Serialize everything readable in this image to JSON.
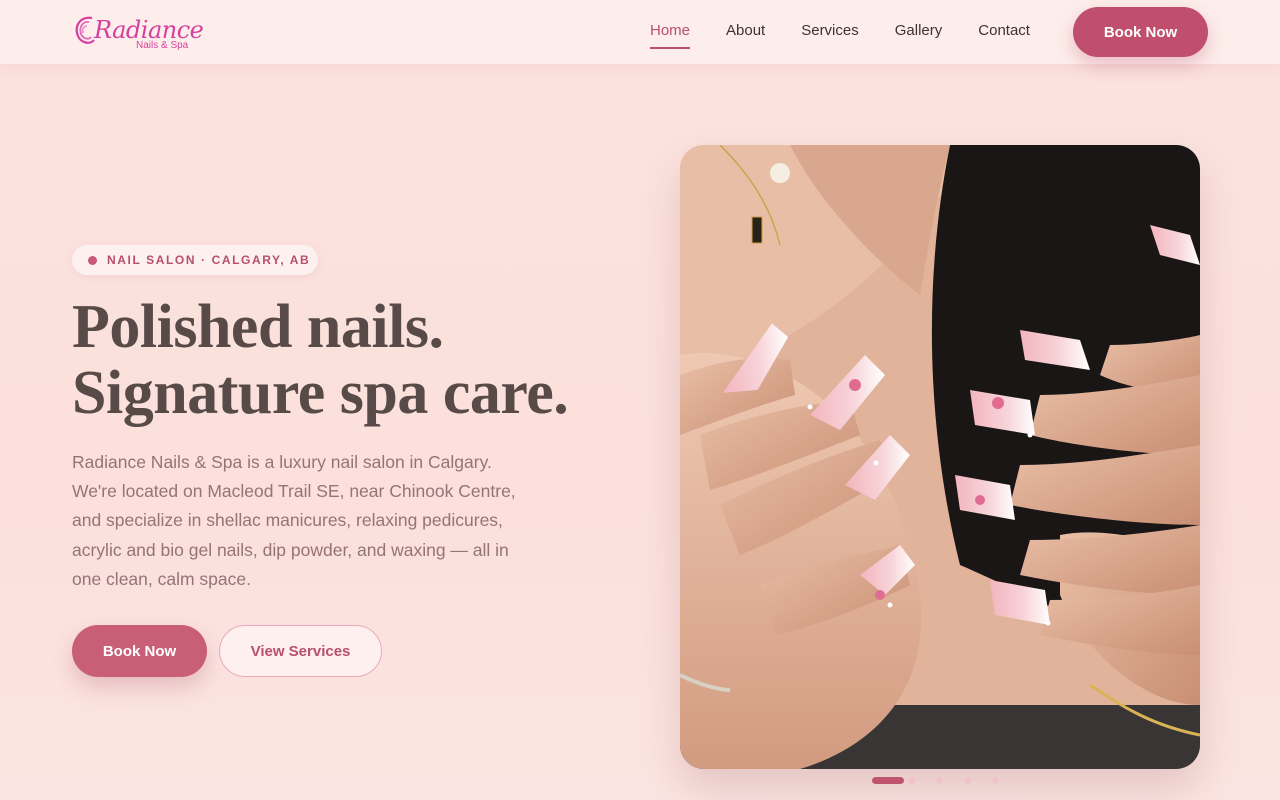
{
  "header": {
    "logo": {
      "word": "Radiance",
      "sub": "Nails & Spa"
    },
    "nav": [
      {
        "label": "Home",
        "active": true
      },
      {
        "label": "About",
        "active": false
      },
      {
        "label": "Services",
        "active": false
      },
      {
        "label": "Gallery",
        "active": false
      },
      {
        "label": "Contact",
        "active": false
      }
    ],
    "cta_label": "Book Now"
  },
  "hero": {
    "badge": "NAIL SALON · CALGARY, AB",
    "headline_line1": "Polished nails.",
    "headline_line2": "Signature spa care.",
    "description": "Radiance Nails & Spa is a luxury nail salon in Calgary. We're located on Macleod Trail SE, near Chinook Centre, and specialize in shellac manicures, relaxing pedicures, acrylic and bio gel nails, dip powder, and waxing — all in one clean, calm space.",
    "primary_button": "Book Now",
    "secondary_button": "View Services",
    "image_icon": "nails-photo",
    "carousel": {
      "count": 5,
      "active_index": 0
    }
  },
  "colors": {
    "accent": "#bf4f6c",
    "background": "#fbe1dc",
    "logo": "#d63fa0"
  }
}
